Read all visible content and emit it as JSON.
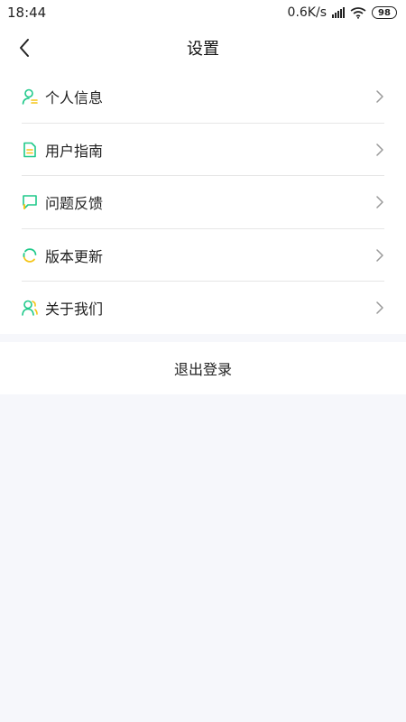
{
  "status_bar": {
    "time": "18:44",
    "network_speed": "0.6K/s",
    "battery": "98"
  },
  "header": {
    "title": "设置",
    "back_icon": "chevron-left-icon"
  },
  "menu": {
    "items": [
      {
        "label": "个人信息",
        "icon": "user-profile-icon"
      },
      {
        "label": "用户指南",
        "icon": "document-icon"
      },
      {
        "label": "问题反馈",
        "icon": "chat-bubble-icon"
      },
      {
        "label": "版本更新",
        "icon": "refresh-icon"
      },
      {
        "label": "关于我们",
        "icon": "users-icon"
      }
    ]
  },
  "logout": {
    "label": "退出登录"
  },
  "colors": {
    "accent_green": "#1fc98a",
    "accent_yellow": "#f5c518",
    "background": "#f6f7fb",
    "divider": "#e6e6e6"
  }
}
